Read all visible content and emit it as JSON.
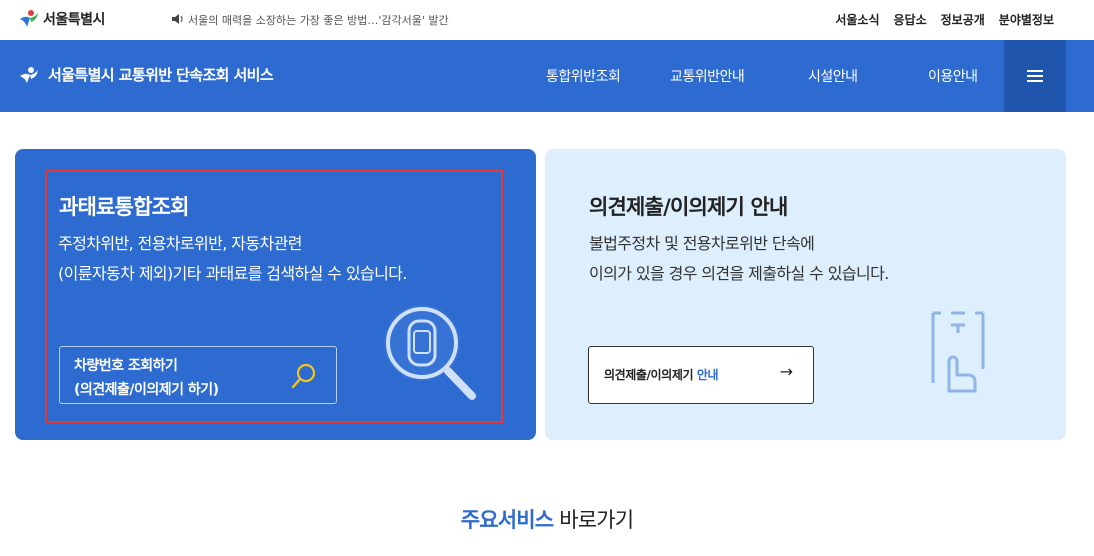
{
  "topbar": {
    "logo_text": "서울특별시",
    "notice": "서울의 매력을 소장하는 가장 좋은 방법…'감각서울' 발간",
    "links": [
      "서울소식",
      "응답소",
      "정보공개",
      "분야별정보"
    ]
  },
  "nav": {
    "service_title": "서울특별시 교통위반 단속조회 서비스",
    "items": [
      "통합위반조회",
      "교통위반안내",
      "시설안내",
      "이용안내"
    ]
  },
  "card_left": {
    "title": "과태료통합조회",
    "desc_line1": "주정차위반, 전용차로위반, 자동차관련",
    "desc_line2": "(이륜자동차 제외)기타 과태료를 검색하실 수 있습니다.",
    "button_line1": "차량번호 조회하기",
    "button_line2": "(의견제출/이의제기 하기)"
  },
  "card_right": {
    "title": "의견제출/이의제기 안내",
    "desc_line1": "불법주정차 및 전용차로위반 단속에",
    "desc_line2": "이의가 있을 경우 의견을 제출하실 수 있습니다.",
    "button_text": "의견제출/이의제기",
    "button_accent": "안내",
    "button_arrow": "→"
  },
  "section": {
    "heading_strong": "주요서비스",
    "heading_rest": "바로가기"
  },
  "colors": {
    "brand_blue": "#2d6bd0",
    "menu_blue": "#1f55ad",
    "light_card": "#ddeefc",
    "highlight": "#e53935",
    "logo_green": "#3fae49",
    "logo_blue": "#2b76d2",
    "logo_red": "#e83b3b"
  }
}
